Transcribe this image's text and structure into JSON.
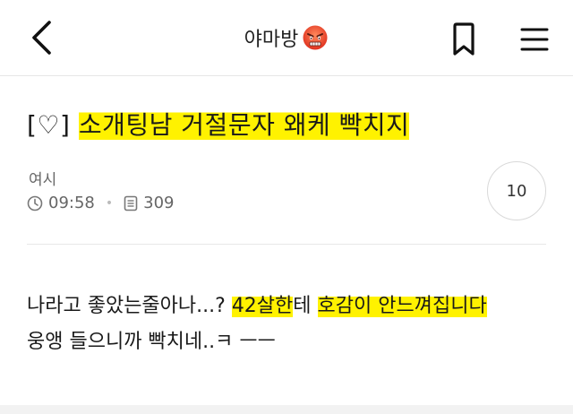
{
  "header": {
    "board_name": "야마방",
    "board_emoji": "angry-face-emoji",
    "back_icon": "chevron-left-icon",
    "bookmark_icon": "bookmark-icon",
    "menu_icon": "hamburger-menu-icon"
  },
  "post": {
    "title_prefix": "[♡] ",
    "title_highlight": "소개팅남 거절문자 왜케 빡치지",
    "author": "여시",
    "time": "09:58",
    "views": "309",
    "comment_count": "10"
  },
  "content": {
    "line1_part1": "나라고 좋았는줄아나...? ",
    "line1_hl1": "42살한",
    "line1_part2": "테 ",
    "line1_hl2": "호감이 안느껴집니다",
    "line2": "웅앵 들으니까 빡치네..ㅋ ㅡㅡ"
  },
  "colors": {
    "highlight": "#fff200",
    "text": "#1a1a1a",
    "muted": "#666666",
    "border": "#e6e6e6"
  }
}
